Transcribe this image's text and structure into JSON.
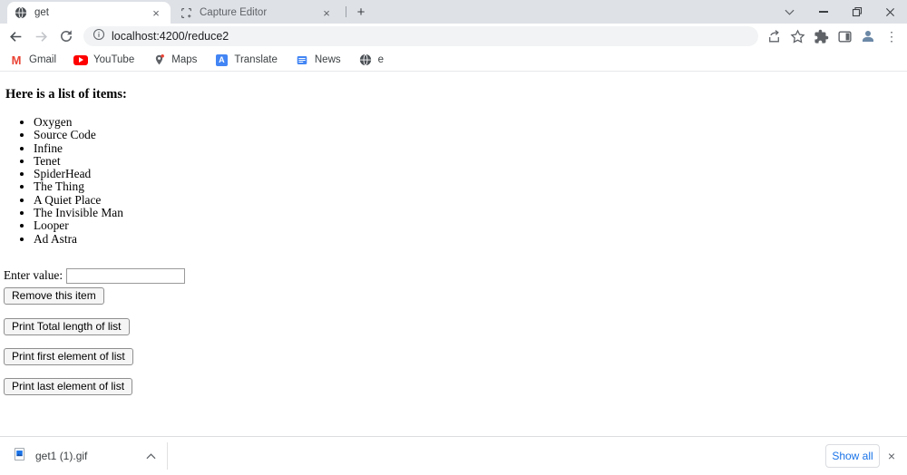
{
  "browser": {
    "tabs": [
      {
        "label": "get"
      },
      {
        "label": "Capture Editor"
      }
    ],
    "url": "localhost:4200/reduce2",
    "bookmarks": [
      {
        "label": "Gmail"
      },
      {
        "label": "YouTube"
      },
      {
        "label": "Maps"
      },
      {
        "label": "Translate"
      },
      {
        "label": "News"
      },
      {
        "label": "e"
      }
    ]
  },
  "glyphs": {
    "close": "×",
    "plus": "+",
    "menu_dots": "⋮"
  },
  "page": {
    "heading": "Here is a list of items:",
    "items": [
      "Oxygen",
      "Source Code",
      "Infine",
      "Tenet",
      "SpiderHead",
      "The Thing",
      "A Quiet Place",
      "The Invisible Man",
      "Looper",
      "Ad Astra"
    ],
    "enter_value_label": "Enter value:",
    "input_value": "",
    "buttons": {
      "remove": "Remove this item",
      "total_length": "Print Total length of list",
      "first_element": "Print first element of list",
      "last_element": "Print last element of list"
    }
  },
  "download_bar": {
    "file_name": "get1 (1).gif",
    "show_all_label": "Show all"
  },
  "colors": {
    "accent_blue": "#1a73e8",
    "tabstrip_bg": "#dee1e6",
    "url_bar_bg": "#f1f3f4",
    "gmail_red": "#ea4335",
    "youtube_red": "#ff0000"
  }
}
